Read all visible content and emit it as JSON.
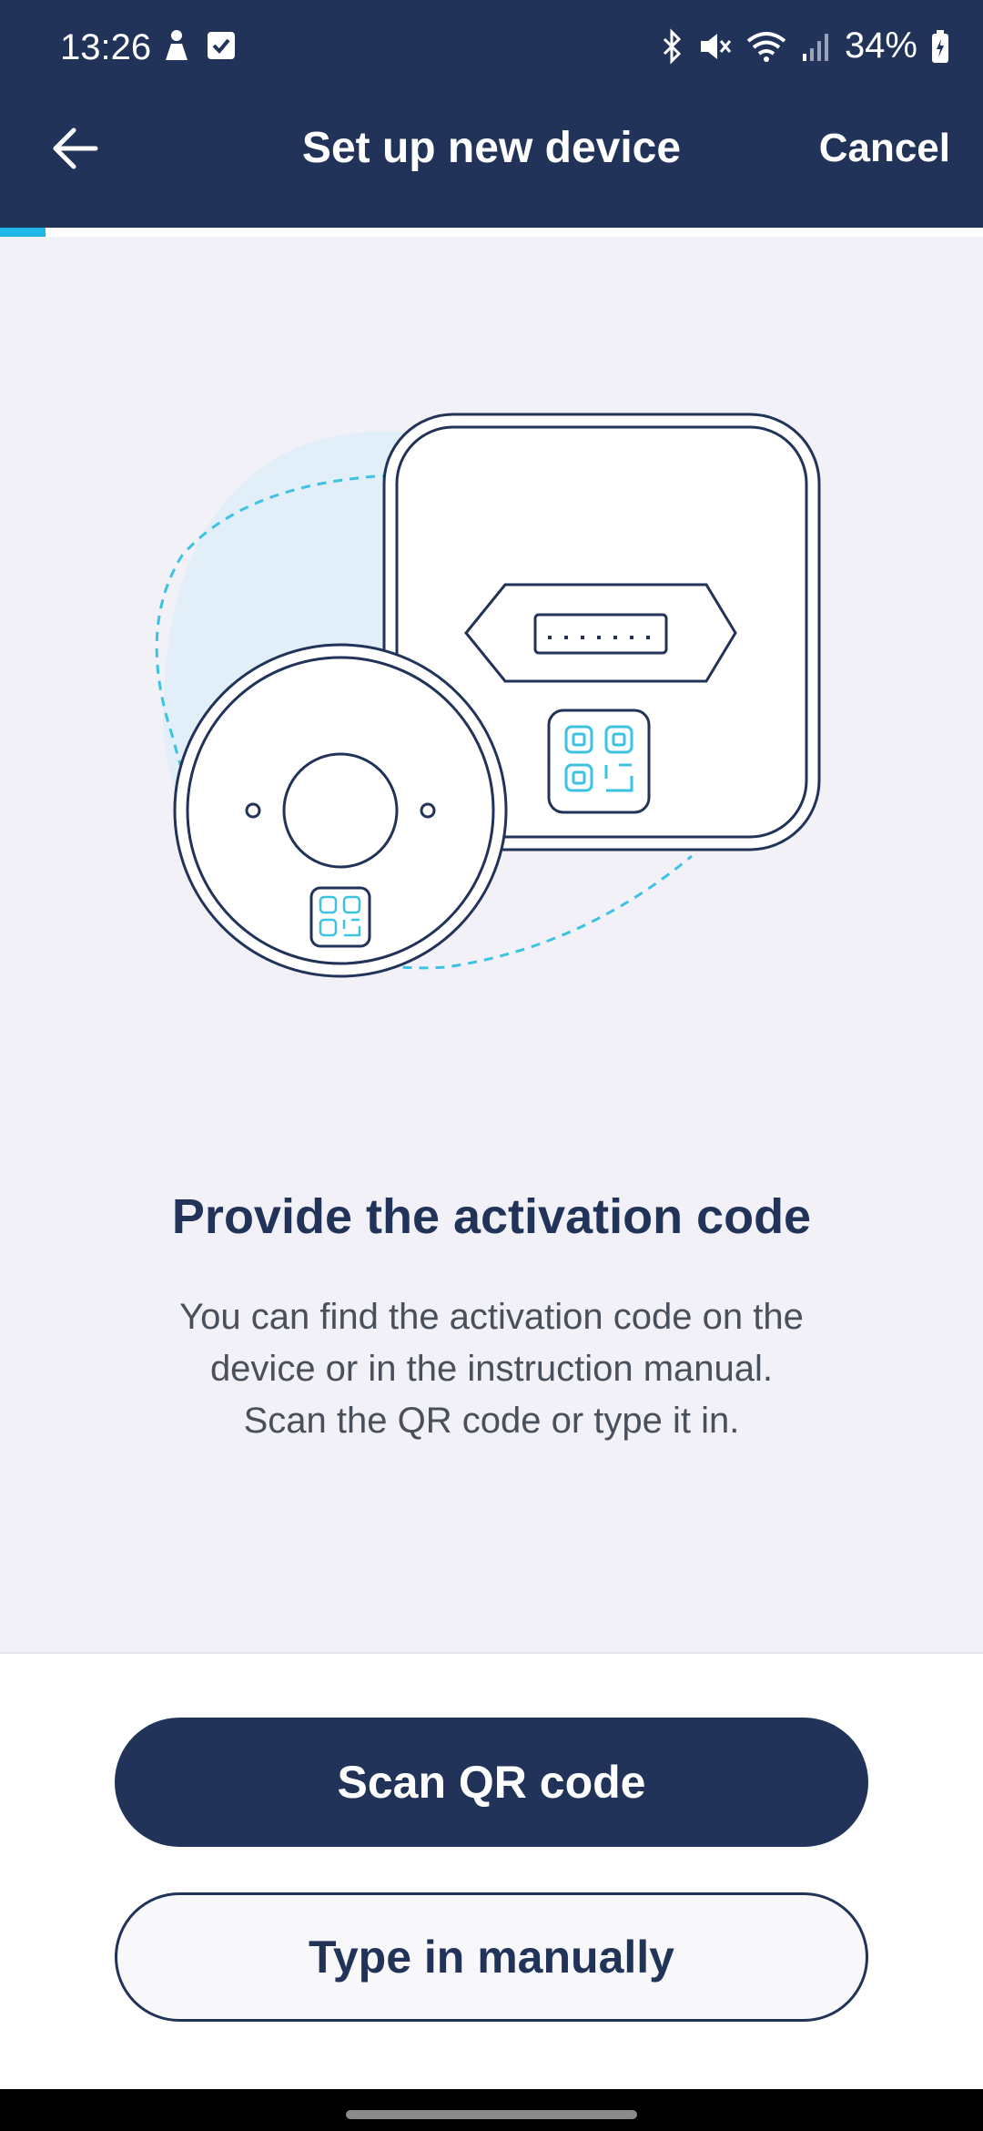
{
  "status_bar": {
    "time": "13:26",
    "battery": "34%",
    "icons": [
      "person-icon",
      "check-box-icon",
      "bluetooth-icon",
      "mute-icon",
      "wifi-icon",
      "signal-icon",
      "battery-charging-icon"
    ]
  },
  "header": {
    "title": "Set up new device",
    "cancel_label": "Cancel",
    "back_icon": "arrow-left-icon",
    "progress": 0.046
  },
  "main": {
    "heading": "Provide the activation code",
    "description_lines": [
      "You can find the activation code on the",
      "device or in the instruction manual.",
      "Scan the QR code or type it in."
    ]
  },
  "actions": {
    "scan_label": "Scan QR code",
    "manual_label": "Type in manually"
  },
  "colors": {
    "navy": "#22335a",
    "accent": "#1fb6e8",
    "background": "#f1f1f7"
  }
}
